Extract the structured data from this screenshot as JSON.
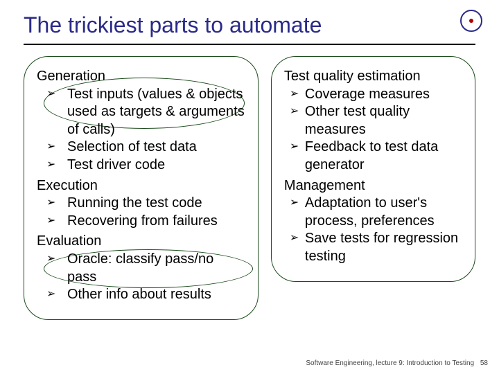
{
  "title": "The trickiest parts to automate",
  "left": {
    "sec1": "Generation",
    "s1i1": "Test inputs (values & objects used as targets & arguments of calls)",
    "s1i2": "Selection of test data",
    "s1i3": "Test driver code",
    "sec2": "Execution",
    "s2i1": "Running the test code",
    "s2i2": "Recovering from failures",
    "sec3": "Evaluation",
    "s3i1": "Oracle: classify pass/no pass",
    "s3i2": "Other info about results"
  },
  "right": {
    "sec1": "Test quality estimation",
    "s1i1": "Coverage measures",
    "s1i2": "Other test quality measures",
    "s1i3": "Feedback to test data generator",
    "sec2": "Management",
    "s2i1": "Adaptation to user's process, preferences",
    "s2i2": "Save tests for regression testing"
  },
  "footer": {
    "text": "Software Engineering, lecture 9: Introduction to Testing",
    "page": "58"
  }
}
